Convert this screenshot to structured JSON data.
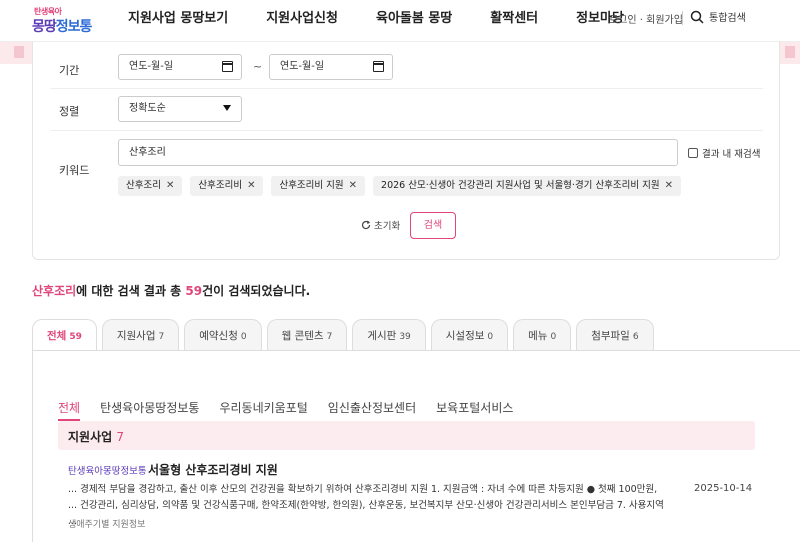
{
  "logo": {
    "line1": "탄생육아",
    "line2a": "몽땅",
    "line2b": "정보통"
  },
  "nav": [
    "지원사업 몽땅보기",
    "지원사업신청",
    "육아돌봄 몽땅",
    "활짝센터",
    "정보마당"
  ],
  "util": {
    "login": "로그인 · 회원가입",
    "search": "통합검색"
  },
  "filter": {
    "period_label": "기간",
    "date_placeholder_start": "연도-월-일",
    "date_placeholder_end": "연도-월-일",
    "tilde": "~",
    "sort_label": "정렬",
    "sort_value": "정확도순",
    "keyword_label": "키워드",
    "keyword_value": "산후조리",
    "recheck_label": "결과 내 재검색",
    "chips": [
      "산후조리",
      "산후조리비",
      "산후조리비 지원",
      "2026 산모·신생아 건강관리 지원사업 및 서울형·경기 산후조리비 지원"
    ],
    "chip_close": "✕",
    "reset": "초기화",
    "search": "검색"
  },
  "summary": {
    "keyword": "산후조리",
    "pre": "에 대한 검색 결과 총 ",
    "count": "59",
    "post": "건이 검색되었습니다."
  },
  "tabs": [
    {
      "label": "전체",
      "count": "59"
    },
    {
      "label": "지원사업",
      "count": "7"
    },
    {
      "label": "예약신청",
      "count": "0"
    },
    {
      "label": "웹 콘텐츠",
      "count": "7"
    },
    {
      "label": "게시판",
      "count": "39"
    },
    {
      "label": "시설정보",
      "count": "0"
    },
    {
      "label": "메뉴",
      "count": "0"
    },
    {
      "label": "첨부파일",
      "count": "6"
    }
  ],
  "subtabs": [
    "전체",
    "탄생육아몽땅정보통",
    "우리동네키움포털",
    "임신출산정보센터",
    "보육포털서비스"
  ],
  "section": {
    "title": "지원사업",
    "count": "7"
  },
  "result": {
    "source": "탄생육아몽땅정보통",
    "title": "서울형 산후조리경비 지원",
    "body": "... 경제적 부담을 경감하고, 출산 이후 산모의 건강권을 확보하기 위하여 산후조리경비 지원 1. 지원금액 : 자녀 수에 따른 차등지원 ● 첫째 100만원, ... 건강관리, 심리상담, 의약품 및 건강식품구매, 한약조제(한약방, 한의원), 산후운동, 보건복지부 산모·신생아 건강관리서비스 본인부담금 7. 사용지역 ...",
    "date": "2025-10-14",
    "tag": "생애주기별 지원정보"
  },
  "colors": {
    "accent": "#e0457b",
    "brand_purple": "#5b3db7"
  }
}
